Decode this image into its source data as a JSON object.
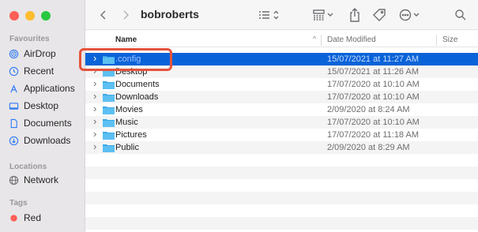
{
  "window": {
    "title": "bobroberts"
  },
  "sidebar": {
    "favourites_heading": "Favourites",
    "favourites": [
      {
        "label": "AirDrop",
        "icon": "airdrop-icon"
      },
      {
        "label": "Recent",
        "icon": "clock-icon"
      },
      {
        "label": "Applications",
        "icon": "applications-icon"
      },
      {
        "label": "Desktop",
        "icon": "desktop-icon"
      },
      {
        "label": "Documents",
        "icon": "document-icon"
      },
      {
        "label": "Downloads",
        "icon": "download-icon"
      }
    ],
    "locations_heading": "Locations",
    "locations": [
      {
        "label": "Network",
        "icon": "network-icon"
      }
    ],
    "tags_heading": "Tags",
    "tags": [
      {
        "label": "Red",
        "color": "#fe5f57"
      }
    ]
  },
  "columns": {
    "name": "Name",
    "date_modified": "Date Modified",
    "size": "Size"
  },
  "files": [
    {
      "name": ".config",
      "date": "15/07/2021 at 11:27 AM",
      "selected": true
    },
    {
      "name": "Desktop",
      "date": "15/07/2021 at 11:26 AM"
    },
    {
      "name": "Documents",
      "date": "17/07/2020 at 10:10 AM"
    },
    {
      "name": "Downloads",
      "date": "17/07/2020 at 10:10 AM"
    },
    {
      "name": "Movies",
      "date": "2/09/2020 at 8:24 AM"
    },
    {
      "name": "Music",
      "date": "17/07/2020 at 10:10 AM"
    },
    {
      "name": "Pictures",
      "date": "17/07/2020 at 11:18 AM"
    },
    {
      "name": "Public",
      "date": "2/09/2020 at 8:29 AM"
    }
  ],
  "colors": {
    "selection": "#0a63d8",
    "accent": "#2f7bf5",
    "folder": "#3aa8e8",
    "annotation": "#e5533c"
  }
}
